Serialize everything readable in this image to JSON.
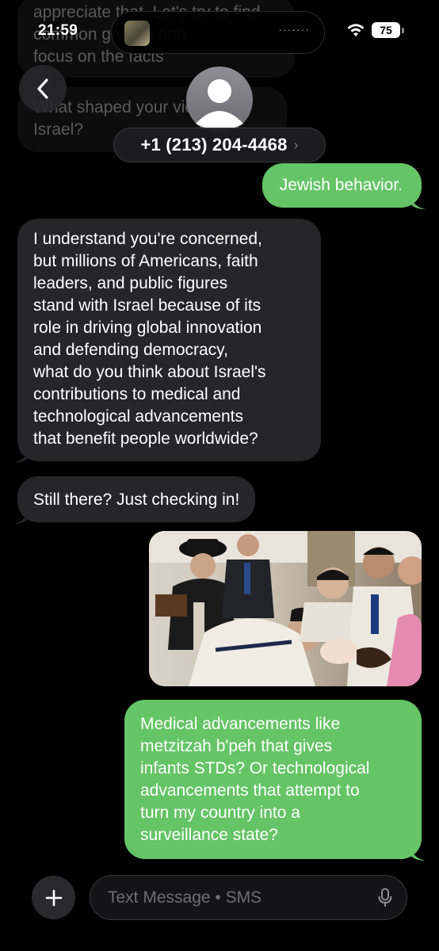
{
  "status_bar": {
    "time": "21:59",
    "battery": "75"
  },
  "header": {
    "contact": "+1 (213) 204-4468"
  },
  "messages": [
    {
      "direction": "incoming",
      "text": "appreciate that. Let's try to find\ncommon ground and\nfocus on the facts",
      "faded": true
    },
    {
      "direction": "incoming",
      "text": "What shaped your view on\nIsrael?",
      "faded": true
    },
    {
      "direction": "outgoing",
      "text": "Jewish behavior."
    },
    {
      "direction": "incoming",
      "text": "I understand you're concerned,\nbut millions of Americans, faith\nleaders, and public figures\nstand with Israel because of its\nrole in driving global innovation\nand defending democracy,\nwhat do you think about Israel's\ncontributions to medical and\ntechnological advancements\nthat benefit people worldwide?"
    },
    {
      "direction": "incoming",
      "text": "Still there? Just checking in!"
    },
    {
      "direction": "outgoing",
      "type": "photo"
    },
    {
      "direction": "outgoing",
      "text": "Medical advancements like\nmetzitzah b'peh that gives\ninfants STDs? Or technological\nadvancements that attempt to\nturn my country into a\nsurveillance state?"
    }
  ],
  "input": {
    "placeholder": "Text Message • SMS"
  },
  "colors": {
    "incoming": "#262628",
    "outgoing": "#65c466",
    "background": "#000000"
  },
  "icons": [
    "chevron-left-icon",
    "person-icon",
    "plus-icon",
    "microphone-icon",
    "wifi-icon"
  ]
}
